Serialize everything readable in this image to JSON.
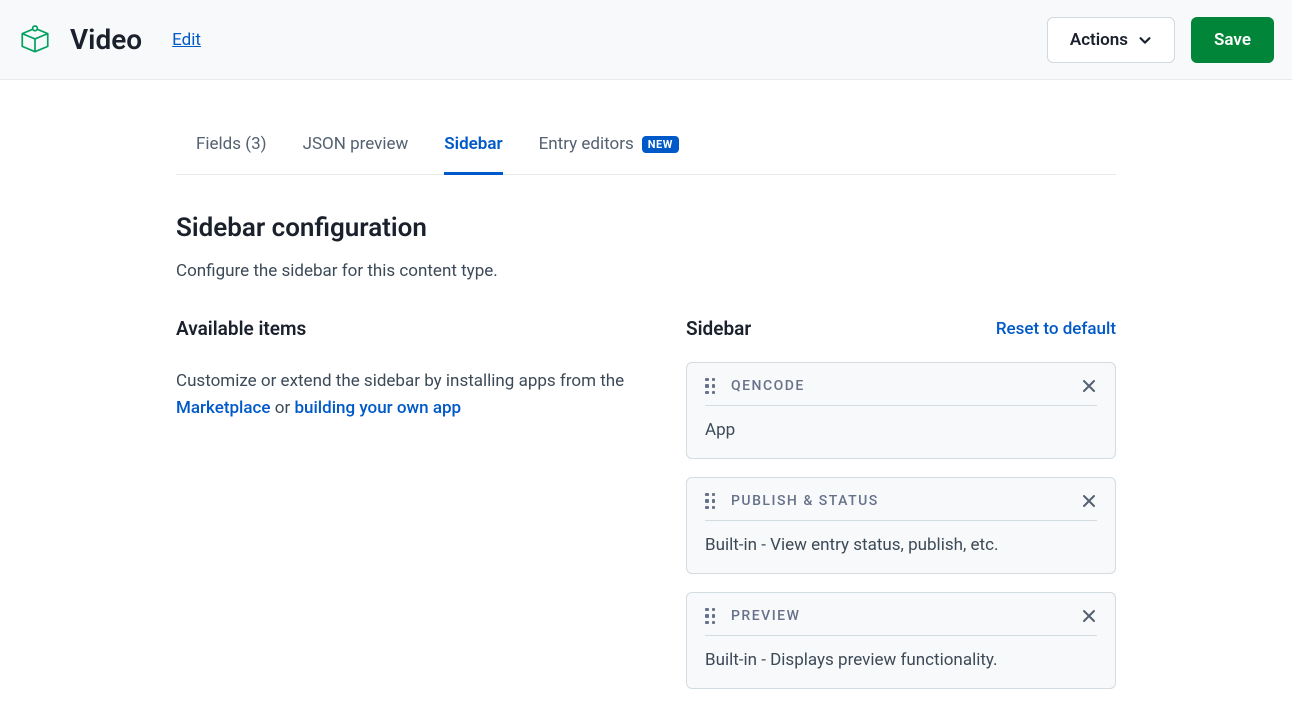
{
  "header": {
    "title": "Video",
    "edit_label": "Edit",
    "actions_label": "Actions",
    "save_label": "Save"
  },
  "tabs": [
    {
      "label": "Fields (3)",
      "active": false,
      "badge": null
    },
    {
      "label": "JSON preview",
      "active": false,
      "badge": null
    },
    {
      "label": "Sidebar",
      "active": true,
      "badge": null
    },
    {
      "label": "Entry editors",
      "active": false,
      "badge": "NEW"
    }
  ],
  "config": {
    "title": "Sidebar configuration",
    "subtitle": "Configure the sidebar for this content type."
  },
  "available": {
    "heading": "Available items",
    "text_1": "Customize or extend the sidebar by installing apps from the ",
    "link_1": "Marketplace",
    "text_2": " or ",
    "link_2": "building your own app"
  },
  "sidebar": {
    "heading": "Sidebar",
    "reset_label": "Reset to default",
    "items": [
      {
        "title": "QENCODE",
        "desc": "App"
      },
      {
        "title": "PUBLISH & STATUS",
        "desc": "Built-in - View entry status, publish, etc."
      },
      {
        "title": "PREVIEW",
        "desc": "Built-in - Displays preview functionality."
      }
    ]
  }
}
